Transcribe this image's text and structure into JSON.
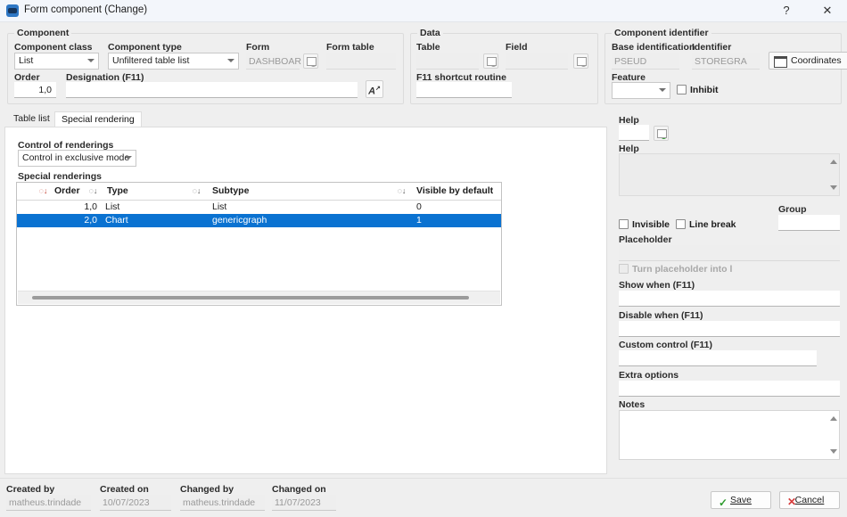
{
  "window": {
    "title": "Form component (Change)",
    "icon": "form-component-icon",
    "help_glyph": "?",
    "close_glyph": "✕"
  },
  "component_group": {
    "title": "Component",
    "component_class": {
      "label": "Component class",
      "value": "List"
    },
    "component_type": {
      "label": "Component type",
      "value": "Unfiltered table list"
    },
    "form": {
      "label": "Form",
      "value": "DASHBOAR"
    },
    "form_table": {
      "label": "Form table",
      "value": ""
    },
    "order": {
      "label": "Order",
      "value": "1,0"
    },
    "designation": {
      "label": "Designation (F11)",
      "value": ""
    },
    "translate_button": "A"
  },
  "data_group": {
    "title": "Data",
    "table": {
      "label": "Table",
      "value": ""
    },
    "field": {
      "label": "Field",
      "value": ""
    },
    "f11_shortcut": {
      "label": "F11 shortcut routine",
      "value": ""
    }
  },
  "identifier_group": {
    "title": "Component identifier",
    "base_identification": {
      "label": "Base identification",
      "value": "PSEUD"
    },
    "identifier": {
      "label": "Identifier",
      "value": "STOREGRA"
    },
    "coordinates_button": "Coordinates",
    "feature": {
      "label": "Feature",
      "value": ""
    },
    "inhibit_checkbox": "Inhibit"
  },
  "tabs": [
    {
      "label": "Table list",
      "active": false
    },
    {
      "label": "Special rendering",
      "active": true
    }
  ],
  "special_rendering": {
    "control_label": "Control of renderings",
    "control_value": "Control in exclusive mode",
    "grid_label": "Special renderings",
    "columns": [
      "Order",
      "Type",
      "Subtype",
      "Visible by default"
    ],
    "rows": [
      {
        "order": "1,0",
        "type": "List",
        "subtype": "List",
        "visible": "0",
        "selected": false
      },
      {
        "order": "2,0",
        "type": "Chart",
        "subtype": "genericgraph",
        "visible": "1",
        "selected": true
      }
    ]
  },
  "right_panel": {
    "help_code_label": "Help",
    "help_code_value": "",
    "help_text_label": "Help",
    "help_text_value": "",
    "invisible_checkbox": "Invisible",
    "line_break_checkbox": "Line break",
    "group": {
      "label": "Group",
      "value": ""
    },
    "placeholder": {
      "label": "Placeholder",
      "value": ""
    },
    "turn_placeholder_checkbox": "Turn placeholder into l",
    "show_when": {
      "label": "Show when (F11)",
      "value": ""
    },
    "disable_when": {
      "label": "Disable when (F11)",
      "value": ""
    },
    "custom_control": {
      "label": "Custom control (F11)",
      "value": ""
    },
    "extra_options": {
      "label": "Extra options",
      "value": ""
    },
    "notes": {
      "label": "Notes",
      "value": ""
    }
  },
  "footer": {
    "created_by": {
      "label": "Created by",
      "value": "matheus.trindade"
    },
    "created_on": {
      "label": "Created on",
      "value": "10/07/2023"
    },
    "changed_by": {
      "label": "Changed by",
      "value": "matheus.trindade"
    },
    "changed_on": {
      "label": "Changed on",
      "value": "11/07/2023"
    },
    "save_button": "Save",
    "cancel_button": "Cancel"
  },
  "colors": {
    "selection": "#0a72d1",
    "background": "#efefef",
    "titlebar": "#f3f6fb",
    "accent_green": "#2e9b2e",
    "accent_red": "#d73b3b"
  }
}
